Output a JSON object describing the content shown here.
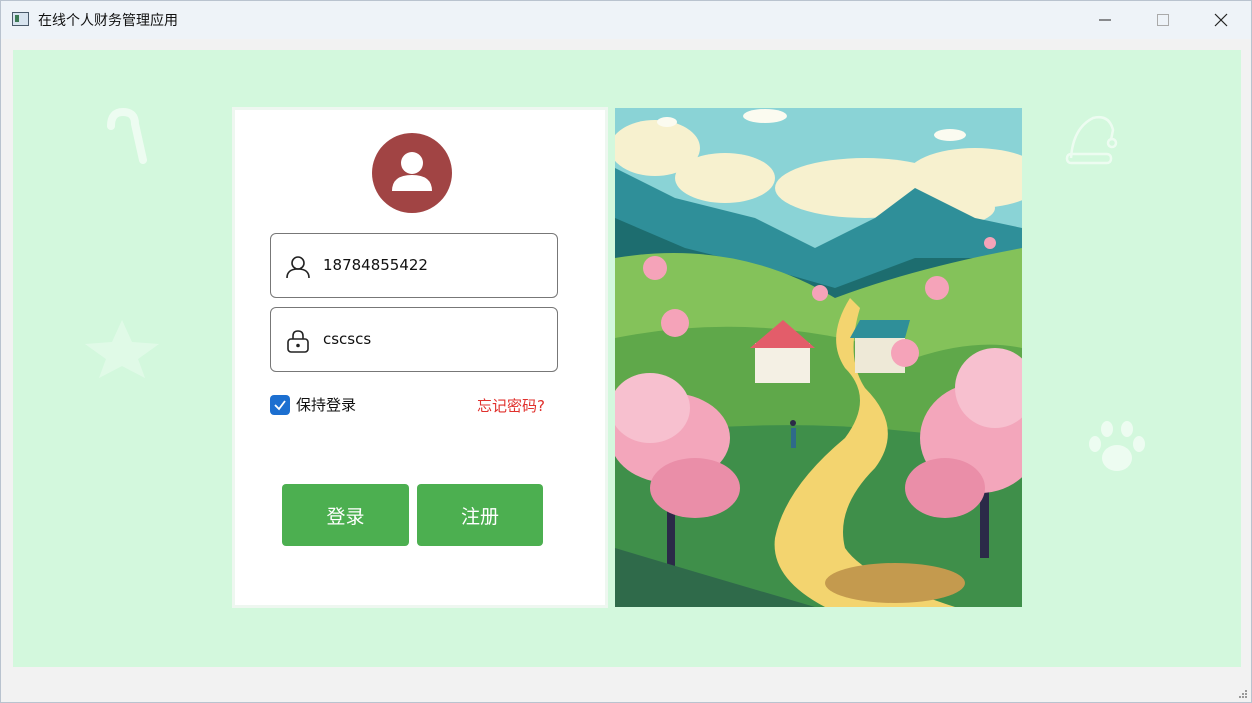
{
  "window": {
    "title": "在线个人财务管理应用",
    "controls": [
      "minimize",
      "maximize",
      "close"
    ]
  },
  "login": {
    "username_value": "18784855422",
    "password_value": "cscscs",
    "remember_label": "保持登录",
    "remember_checked": true,
    "forgot_label": "忘记密码?",
    "login_button": "登录",
    "register_button": "注册"
  },
  "colors": {
    "background": "#d3f8dd",
    "accent_button": "#4caf50",
    "avatar": "#a14444",
    "link": "#e0312d",
    "checkbox": "#1c6fd0"
  },
  "icons": [
    "user-icon",
    "lock-icon",
    "check-icon",
    "avatar-icon",
    "candy-cane-icon",
    "star-icon",
    "santa-hat-icon",
    "paw-icon"
  ]
}
